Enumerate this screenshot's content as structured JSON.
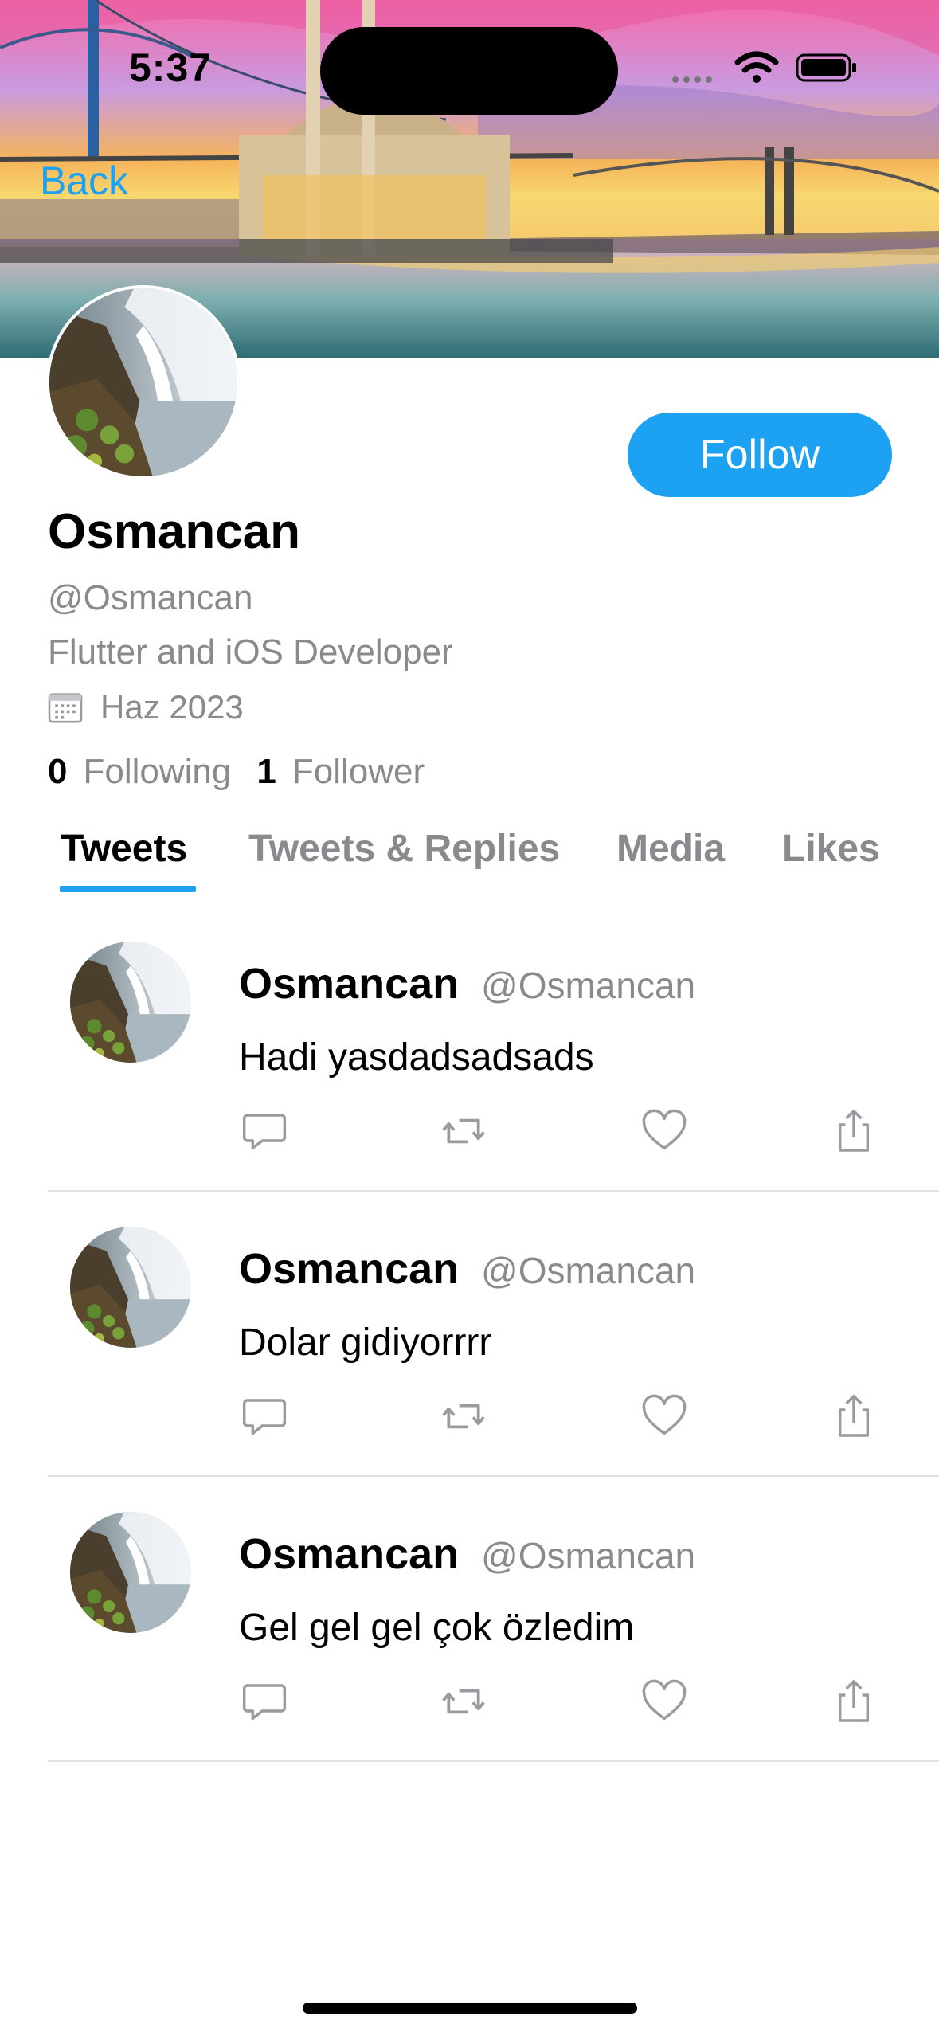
{
  "status_bar": {
    "time": "5:37"
  },
  "nav": {
    "back_label": "Back"
  },
  "profile": {
    "display_name": "Osmancan",
    "handle": "@Osmancan",
    "bio": "Flutter and iOS Developer",
    "joined": "Haz 2023",
    "following_count": "0",
    "following_label": "Following",
    "followers_count": "1",
    "followers_label": "Follower",
    "follow_button_label": "Follow"
  },
  "tabs": [
    {
      "label": "Tweets",
      "active": true
    },
    {
      "label": "Tweets & Replies",
      "active": false
    },
    {
      "label": "Media",
      "active": false
    },
    {
      "label": "Likes",
      "active": false
    }
  ],
  "tweets": [
    {
      "name": "Osmancan",
      "handle": "@Osmancan",
      "text": "Hadi yasdadsadsads"
    },
    {
      "name": "Osmancan",
      "handle": "@Osmancan",
      "text": "Dolar gidiyorrrr"
    },
    {
      "name": "Osmancan",
      "handle": "@Osmancan",
      "text": "Gel gel gel çok özledim"
    }
  ],
  "icons": {
    "reply": "comment-icon",
    "retweet": "retweet-icon",
    "like": "heart-icon",
    "share": "share-icon",
    "calendar": "calendar-icon"
  },
  "colors": {
    "accent": "#1da1f2",
    "secondary_text": "#8a8a8e",
    "divider": "#e2e2e4"
  }
}
